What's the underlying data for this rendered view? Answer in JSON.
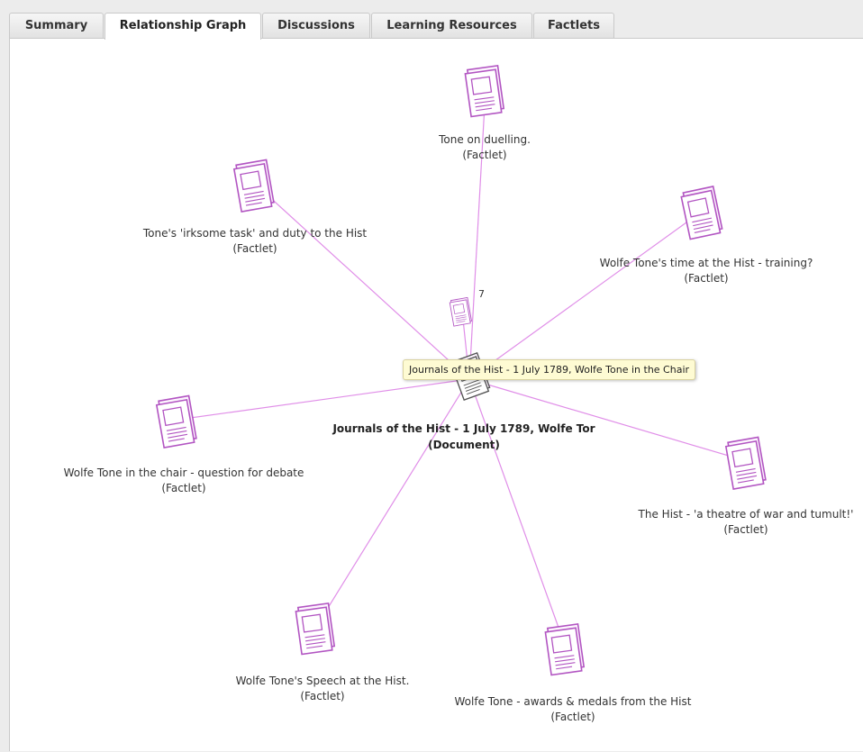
{
  "tabs": [
    {
      "label": "Summary",
      "active": false
    },
    {
      "label": "Relationship Graph",
      "active": true
    },
    {
      "label": "Discussions",
      "active": false
    },
    {
      "label": "Learning Resources",
      "active": false
    },
    {
      "label": "Factlets",
      "active": false
    }
  ],
  "graph": {
    "center": {
      "title": "Journals of the Hist - 1 July 1789, Wolfe Tone in the Chair",
      "title_truncated": "Journals of the Hist - 1 July 1789, Wolfe Tor",
      "type": "(Document)",
      "icon": "document-icon"
    },
    "tooltip": "Journals of the Hist - 1 July 1789, Wolfe Tone in the Chair",
    "cluster": {
      "count": "7",
      "icon": "factlet-icon"
    },
    "nodes": [
      {
        "title": "Tone on duelling.",
        "type": "(Factlet)"
      },
      {
        "title": "Tone's 'irksome task' and duty to the Hist",
        "type": "(Factlet)"
      },
      {
        "title": "Wolfe Tone's time at the Hist - training?",
        "type": "(Factlet)"
      },
      {
        "title": "Wolfe Tone in the chair - question for debate",
        "type": "(Factlet)"
      },
      {
        "title": "The Hist - 'a theatre of war and tumult!'",
        "type": "(Factlet)"
      },
      {
        "title": "Wolfe Tone's Speech at the Hist.",
        "type": "(Factlet)"
      },
      {
        "title": "Wolfe Tone - awards & medals from the Hist",
        "type": "(Factlet)"
      }
    ],
    "colors": {
      "edge": "#e08ee8",
      "factlet": "#b255c2",
      "document": "#555555"
    }
  }
}
